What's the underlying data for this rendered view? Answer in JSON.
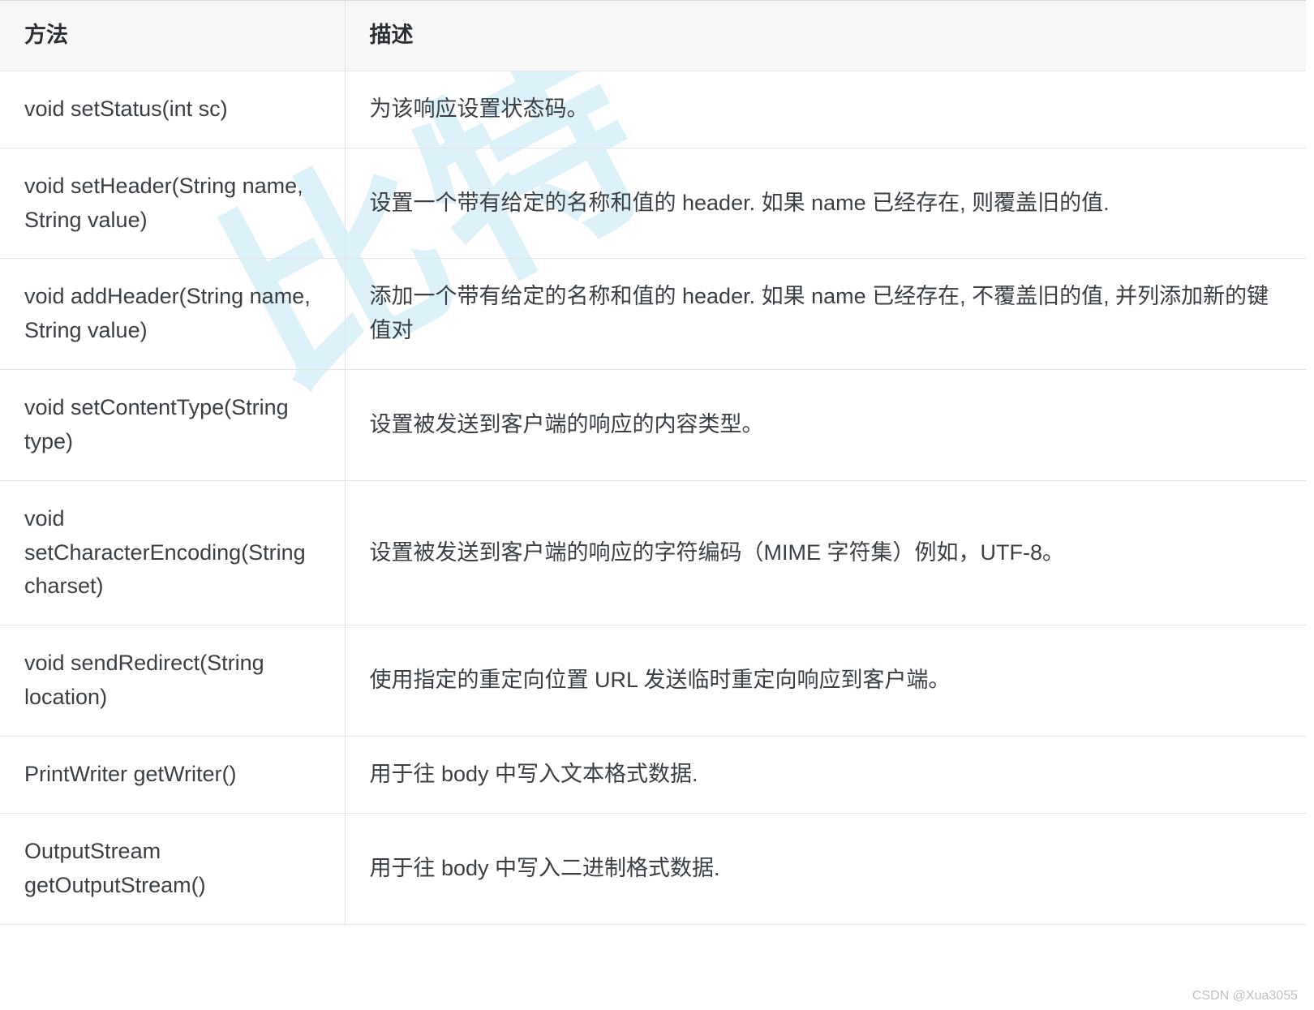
{
  "watermark": "比特",
  "credit": "CSDN @Xua3055",
  "table": {
    "headers": {
      "method": "方法",
      "desc": "描述"
    },
    "rows": [
      {
        "method": "void setStatus(int sc)",
        "desc": "为该响应设置状态码。"
      },
      {
        "method": "void setHeader(String name, String value)",
        "desc": "设置一个带有给定的名称和值的 header. 如果 name 已经存在, 则覆盖旧的值."
      },
      {
        "method": "void addHeader(String name, String value)",
        "desc": "添加一个带有给定的名称和值的 header. 如果 name 已经存在, 不覆盖旧的值, 并列添加新的键值对"
      },
      {
        "method": "void setContentType(String type)",
        "desc": "设置被发送到客户端的响应的内容类型。"
      },
      {
        "method": "void setCharacterEncoding(String charset)",
        "desc": "设置被发送到客户端的响应的字符编码（MIME 字符集）例如，UTF-8。"
      },
      {
        "method": "void sendRedirect(String location)",
        "desc": "使用指定的重定向位置 URL 发送临时重定向响应到客户端。"
      },
      {
        "method": "PrintWriter getWriter()",
        "desc": "用于往 body 中写入文本格式数据."
      },
      {
        "method": "OutputStream getOutputStream()",
        "desc": "用于往 body 中写入二进制格式数据."
      }
    ]
  }
}
